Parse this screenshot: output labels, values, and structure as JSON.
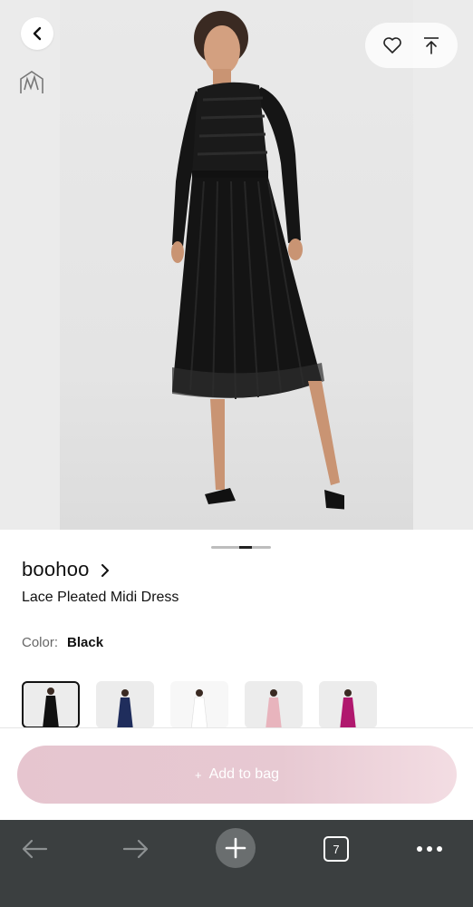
{
  "header": {
    "back_icon": "chevron-left-icon",
    "logo_icon": "brand-logo-icon",
    "favorite_icon": "heart-icon",
    "share_icon": "share-icon"
  },
  "product": {
    "brand": "boohoo",
    "name": "Lace Pleated Midi Dress",
    "color_label": "Color:",
    "color_value": "Black"
  },
  "swatches": [
    {
      "name": "Black",
      "color": "#111111",
      "selected": true
    },
    {
      "name": "Navy",
      "color": "#1f2d5c",
      "selected": false
    },
    {
      "name": "White",
      "color": "#f4f4f4",
      "selected": false
    },
    {
      "name": "Pink",
      "color": "#e8b4bd",
      "selected": false
    },
    {
      "name": "Magenta",
      "color": "#b0186e",
      "selected": false
    }
  ],
  "cart": {
    "add_to_bag_label": "Add to bag",
    "plus_glyph": "+"
  },
  "browser": {
    "tab_count": "7",
    "back_icon": "arrow-left-icon",
    "forward_icon": "arrow-right-icon",
    "new_tab_icon": "plus-icon",
    "more_icon": "more-dots-icon"
  },
  "colors": {
    "accent_button": "#e6c5cf",
    "browser_bar": "#3b3f40"
  }
}
